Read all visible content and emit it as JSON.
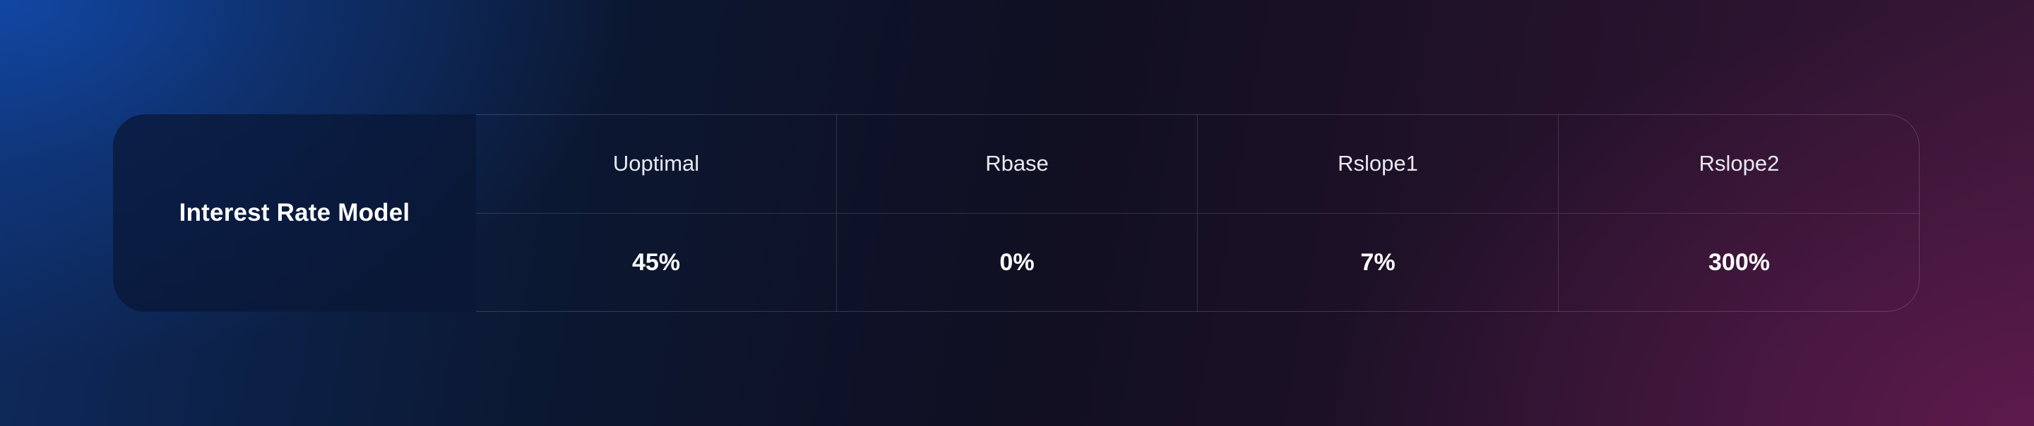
{
  "table": {
    "row_header": "Interest Rate Model",
    "columns": [
      {
        "label": "Uoptimal",
        "value": "45%"
      },
      {
        "label": "Rbase",
        "value": "0%"
      },
      {
        "label": "Rslope1",
        "value": "7%"
      },
      {
        "label": "Rslope2",
        "value": "300%"
      }
    ]
  },
  "colors": {
    "background_top_left": "#124cb0",
    "background_bottom_right": "#601a4e",
    "text": "#ffffff",
    "divider": "rgba(255,255,255,0.14)"
  }
}
